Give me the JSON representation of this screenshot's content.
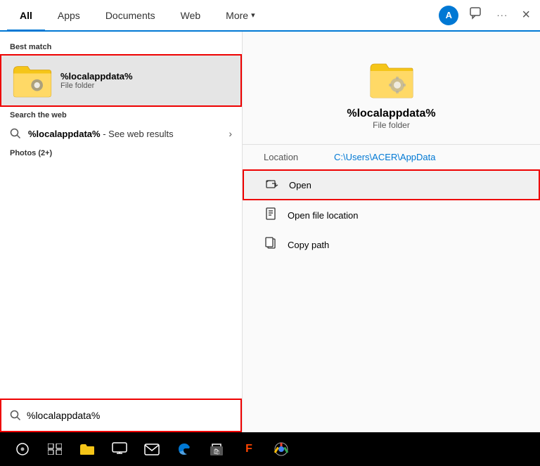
{
  "nav": {
    "tabs": [
      {
        "label": "All",
        "active": true
      },
      {
        "label": "Apps",
        "active": false
      },
      {
        "label": "Documents",
        "active": false
      },
      {
        "label": "Web",
        "active": false
      },
      {
        "label": "More",
        "active": false
      }
    ],
    "avatar_label": "A",
    "more_chevron": "▾",
    "close_label": "×",
    "ellipsis_label": "···"
  },
  "left": {
    "best_match_label": "Best match",
    "result_title": "%localappdata%",
    "result_sub": "File folder",
    "search_web_label": "Search the web",
    "web_query": "%localappdata%",
    "web_suffix": " - See web results",
    "photos_label": "Photos (2+)"
  },
  "right": {
    "folder_title": "%localappdata%",
    "folder_sub": "File folder",
    "detail_label": "Location",
    "detail_value": "C:\\Users\\ACER\\AppData",
    "actions": [
      {
        "label": "Open",
        "icon": "⬛",
        "highlighted": true
      },
      {
        "label": "Open file location",
        "icon": "📄"
      },
      {
        "label": "Copy path",
        "icon": "📋"
      }
    ]
  },
  "searchbar": {
    "value": "%localappdata%",
    "placeholder": ""
  },
  "taskbar": {
    "items": [
      "⊙",
      "⊞",
      "🗂",
      "💻",
      "✉",
      "🌐",
      "🛍",
      "🎨",
      "🌍"
    ]
  }
}
